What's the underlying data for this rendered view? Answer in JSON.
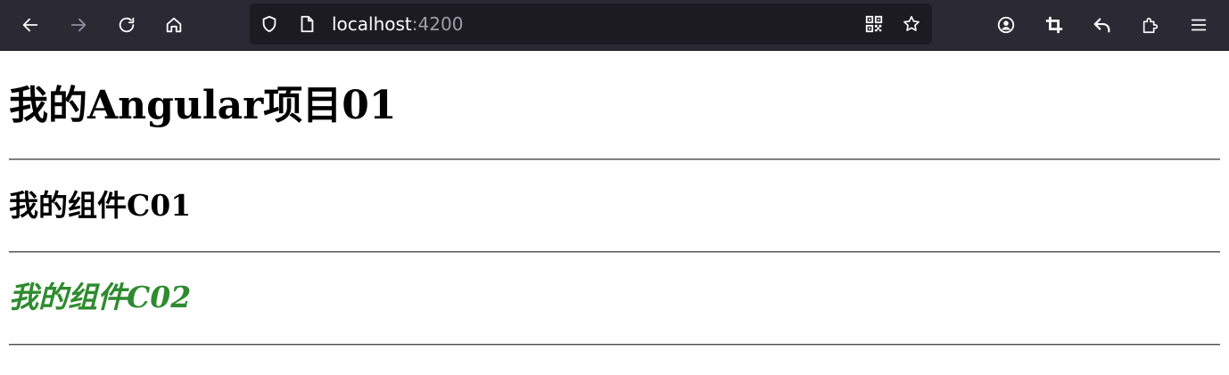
{
  "browser": {
    "url_host": "localhost",
    "url_port": ":4200",
    "icons": {
      "back": "back-arrow-icon",
      "forward": "forward-arrow-icon",
      "reload": "reload-icon",
      "home": "home-icon",
      "shield": "shield-icon",
      "page": "page-icon",
      "qr": "qr-code-icon",
      "star": "bookmark-star-icon",
      "account": "account-icon",
      "crop": "screenshot-crop-icon",
      "undo": "undo-arrow-icon",
      "extensions": "extensions-puzzle-icon",
      "menu": "hamburger-menu-icon"
    }
  },
  "page": {
    "title": "我的Angular项目01",
    "component1_title": "我的组件C01",
    "component2_title": "我的组件C02"
  },
  "colors": {
    "toolbar_bg": "#2b2a33",
    "urlbar_bg": "#1c1b22",
    "component2_text": "#2e8b2e"
  }
}
